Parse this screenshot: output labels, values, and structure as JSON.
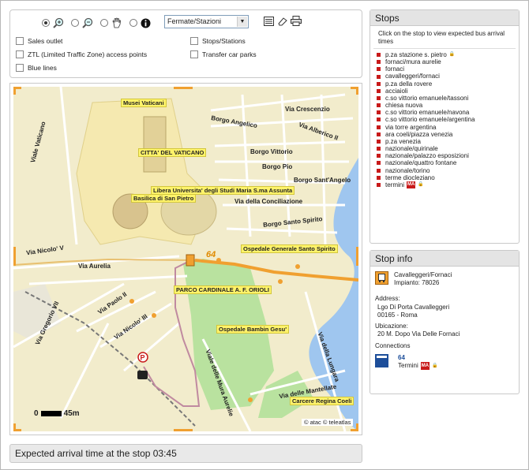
{
  "toolbar": {
    "tools": [
      {
        "icon": "pan-icon"
      },
      {
        "icon": "zoom-in-icon"
      },
      {
        "icon": "zoom-out-icon"
      },
      {
        "icon": "hand-icon"
      },
      {
        "icon": "info-icon"
      }
    ],
    "select_value": "Fermate/Stazioni",
    "extra_icons": [
      "list-icon",
      "erase-icon",
      "print-icon"
    ]
  },
  "filters": {
    "sales_outlet": "Sales outlet",
    "ztl": "ZTL (Limited Traffic Zone) access points",
    "blue_lines": "Blue lines",
    "stops_stations": "Stops/Stations",
    "transfer_car_parks": "Transfer car parks"
  },
  "map": {
    "streets": {
      "viale_vaticano": "Viale Vaticano",
      "via_crescenzio": "Via Crescenzio",
      "borgo_angelico": "Borgo Angelico",
      "via_alberico": "Via Alberico II",
      "borgo_vittorio": "Borgo Vittorio",
      "borgo_pio": "Borgo Pio",
      "borgo_santangelo": "Borgo Sant'Angelo",
      "via_conciliazione": "Via della Conciliazione",
      "borgo_santo_spirito": "Borgo Santo Spirito",
      "via_nicolo_v": "Via Nicolo' V",
      "via_aurelia": "Via Aurelia",
      "via_paolo_ii": "Via Paolo II",
      "via_nicolo_iii": "Via Nicolo' III",
      "via_gregorio": "Via Gregorio VII",
      "viale_mura_aurelie": "Viale delle Mura Aurelie",
      "via_lungara": "Via della Lungara",
      "via_mantellate": "Via delle Mantellate"
    },
    "pois": {
      "musei_vaticani": "Musei Vaticani",
      "citta_vaticano": "CITTA' DEL VATICANO",
      "lumsa": "Libera Universita' degli Studi Maria S.ma Assunta",
      "basilica": "Basilica di San Pietro",
      "ospedale_santo_spirito": "Ospedale Generale Santo Spirito",
      "parco": "PARCO CARDINALE A. F. ORIOLI",
      "bambin_gesu": "Ospedale Bambin Gesu'",
      "regina_coeli": "Carcere Regina Coeli"
    },
    "bus_number": "64",
    "scale_left": "0",
    "scale_right": "45m",
    "credit": "© atac © teleatlas"
  },
  "arrival": "Expected arrival time at the stop 03:45",
  "stops": {
    "title": "Stops",
    "intro": "Click on the stop to view expected bus arrival times",
    "items": [
      {
        "name": "p.za stazione s. pietro",
        "lock": true,
        "metro": false
      },
      {
        "name": "fornaci/mura aurelie",
        "lock": false,
        "metro": false
      },
      {
        "name": "fornaci",
        "lock": false,
        "metro": false
      },
      {
        "name": "cavalleggeri/fornaci",
        "lock": false,
        "metro": false
      },
      {
        "name": "p.za della rovere",
        "lock": false,
        "metro": false
      },
      {
        "name": "acciaioli",
        "lock": false,
        "metro": false
      },
      {
        "name": "c.so vittorio emanuele/tassoni",
        "lock": false,
        "metro": false
      },
      {
        "name": "chiesa nuova",
        "lock": false,
        "metro": false
      },
      {
        "name": "c.so vittorio emanuele/navona",
        "lock": false,
        "metro": false
      },
      {
        "name": "c.so vittorio emanuele/argentina",
        "lock": false,
        "metro": false
      },
      {
        "name": "via torre argentina",
        "lock": false,
        "metro": false
      },
      {
        "name": "ara coeli/piazza venezia",
        "lock": false,
        "metro": false
      },
      {
        "name": "p.za venezia",
        "lock": false,
        "metro": false
      },
      {
        "name": "nazionale/quirinale",
        "lock": false,
        "metro": false
      },
      {
        "name": "nazionale/palazzo esposizioni",
        "lock": false,
        "metro": false
      },
      {
        "name": "nazionale/quattro fontane",
        "lock": false,
        "metro": false
      },
      {
        "name": "nazionale/torino",
        "lock": false,
        "metro": false
      },
      {
        "name": "terme diocleziano",
        "lock": false,
        "metro": false
      },
      {
        "name": "termini",
        "lock": true,
        "metro": true
      }
    ],
    "metro_badge": "MA"
  },
  "stop_info": {
    "title": "Stop info",
    "name": "Cavalleggeri/Fornaci",
    "impianto": "Impianto:  78026",
    "address_label": "Address:",
    "address_line1": "Lgo Di Porta Cavalleggeri",
    "address_line2": "00165 - Roma",
    "ubicazione_label": "Ubicazione:",
    "ubicazione_value": "20 M. Dopo Via Delle Fornaci",
    "connections_label": "Connections",
    "line_number": "64",
    "line_dest": "Termini",
    "line_badge": "MA"
  },
  "colors": {
    "accent_orange": "#f0a030",
    "poi_yellow": "#fff36a",
    "bullet_red": "#c81a1a",
    "river": "#9fc6ef",
    "park": "#b9e29f"
  }
}
